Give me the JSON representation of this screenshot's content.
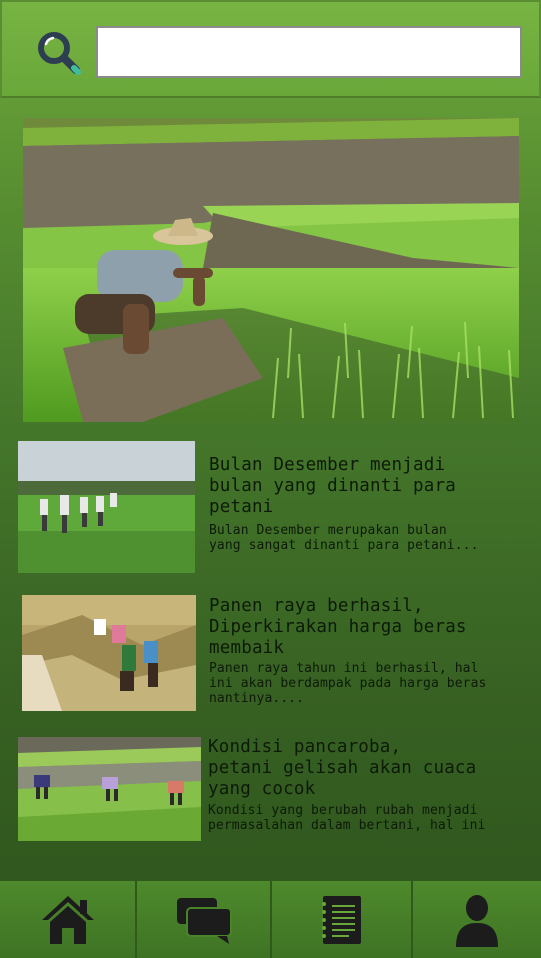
{
  "search": {
    "icon": "search-icon",
    "value": "",
    "placeholder": ""
  },
  "hero": {
    "image": "farmer-in-rice-terrace-photo"
  },
  "articles": [
    {
      "image": "farmers-walking-in-field-photo",
      "title": "Bulan Desember menjadi\nbulan yang dinanti para\npetani",
      "excerpt": "Bulan Desember merupakan bulan\nyang sangat dinanti para petani..."
    },
    {
      "image": "rice-harvest-photo",
      "title": "Panen raya berhasil,\nDiperkirakan harga beras\nmembaik",
      "excerpt": "Panen raya tahun ini berhasil, hal\nini akan berdampak pada harga beras\nnantinya...."
    },
    {
      "image": "farmers-planting-rice-photo",
      "title": "Kondisi pancaroba,\npetani gelisah akan cuaca\nyang cocok",
      "excerpt": "Kondisi yang berubah rubah menjadi\npermasalahan dalam bertani, hal ini"
    }
  ],
  "nav": [
    {
      "icon": "home-icon"
    },
    {
      "icon": "chat-icon"
    },
    {
      "icon": "notepad-icon"
    },
    {
      "icon": "user-icon"
    }
  ],
  "colors": {
    "header": "#78b443",
    "background_top": "#6fa93e",
    "background_bottom": "#2e551d",
    "navbar": "#4e8a2c",
    "icon_dark": "#1c1c1c",
    "search_icon_accent": "#3fbfa0"
  }
}
